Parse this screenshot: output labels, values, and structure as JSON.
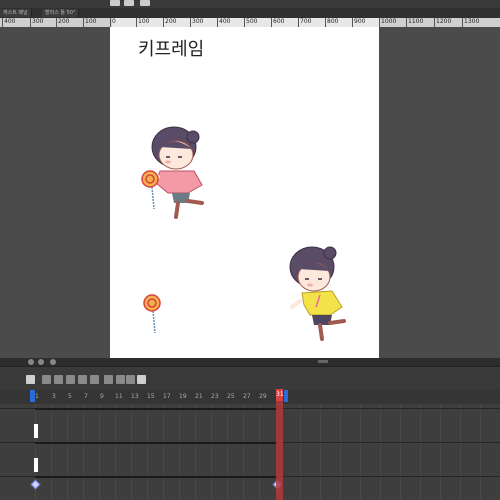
{
  "app": {
    "tabs": [
      "캐스트 패널",
      "할러스 툴 50°"
    ]
  },
  "ruler": {
    "labels": [
      "400",
      "300",
      "200",
      "100",
      "0",
      "100",
      "200",
      "300",
      "400",
      "500",
      "600",
      "700",
      "800",
      "900",
      "1000",
      "1100",
      "1200",
      "1300"
    ]
  },
  "canvas": {
    "title": "키프레임"
  },
  "timeline": {
    "frame_labels": [
      "1",
      "3",
      "5",
      "7",
      "9",
      "11",
      "13",
      "15",
      "17",
      "19",
      "21",
      "23",
      "25",
      "27",
      "29",
      "31"
    ],
    "current_frame": "31"
  },
  "colors": {
    "playhead": "#d84242",
    "range_marker": "#2b6ad9",
    "canvas": "#ffffff",
    "workspace": "#4b4b4b"
  }
}
